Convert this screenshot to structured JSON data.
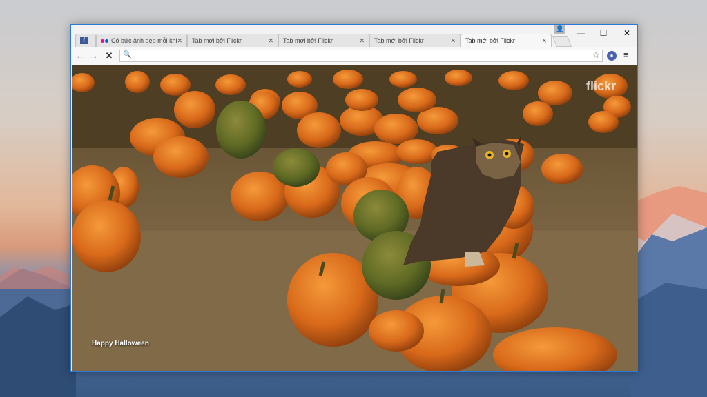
{
  "tabs": [
    {
      "label": "",
      "icon": "facebook-icon",
      "active": false
    },
    {
      "label": "Có bức ảnh đẹp mỗi khi",
      "icon": "flickr-icon",
      "active": false
    },
    {
      "label": "Tab mới bởi Flickr",
      "active": false
    },
    {
      "label": "Tab mới bởi Flickr",
      "active": false
    },
    {
      "label": "Tab mới bởi Flickr",
      "active": false
    },
    {
      "label": "Tab mới bởi Flickr",
      "active": true
    }
  ],
  "omnibox": {
    "value": "",
    "placeholder": ""
  },
  "content": {
    "caption": "Happy Halloween",
    "watermark": "flickr"
  },
  "colors": {
    "accent": "#2b79d6",
    "pumpkin": "#e0761f"
  }
}
